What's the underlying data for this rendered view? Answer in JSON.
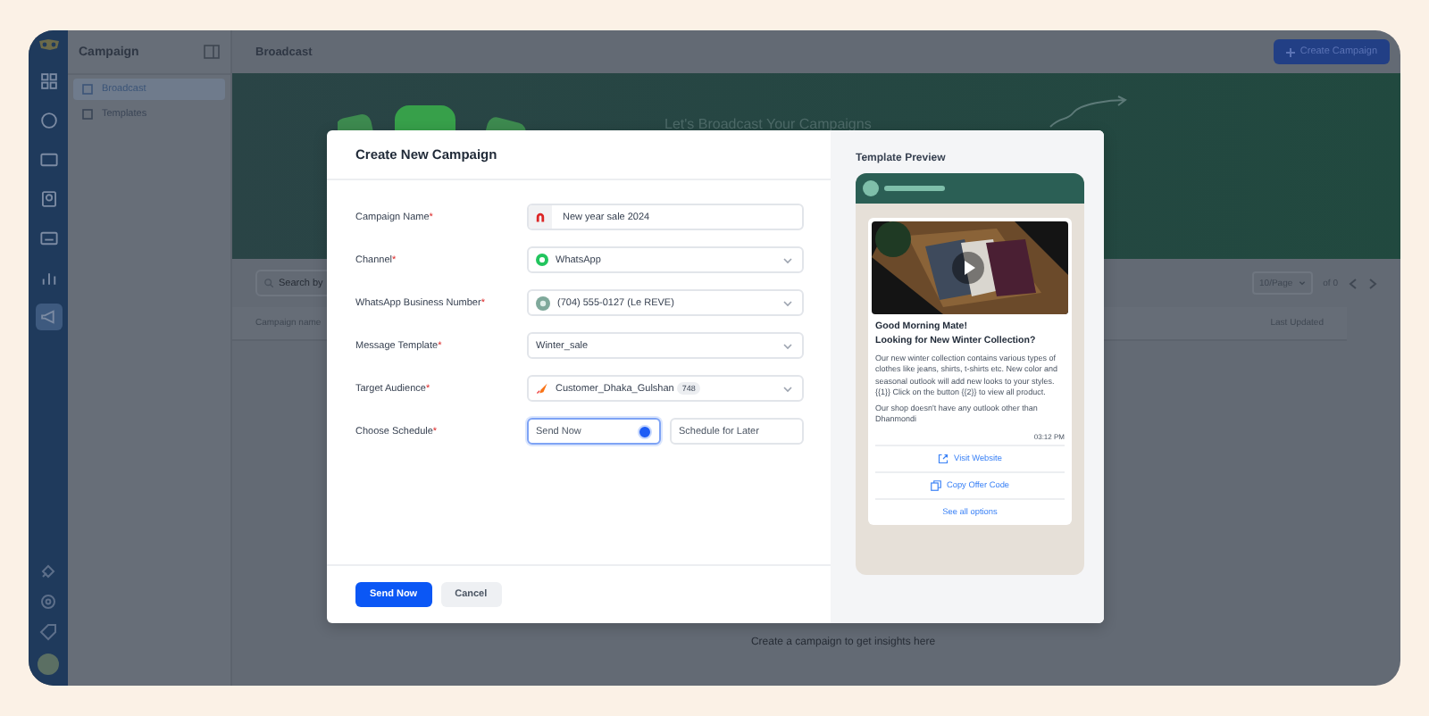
{
  "rail_items": [
    {
      "selected": false
    },
    {
      "selected": false
    },
    {
      "selected": false
    },
    {
      "selected": false
    },
    {
      "selected": false
    },
    {
      "selected": false
    },
    {
      "selected": true
    }
  ],
  "secondary_sidebar": {
    "title": "Campaign",
    "items": [
      {
        "label": "Broadcast",
        "selected": true
      },
      {
        "label": "Templates",
        "selected": false
      }
    ]
  },
  "header": {
    "title": "Broadcast",
    "button": "Create Campaign"
  },
  "banner": {
    "headline": "Let's Broadcast Your Campaigns"
  },
  "list": {
    "search_placeholder": "Search by",
    "page_size": "10/Page",
    "page_info": "of 0",
    "columns": [
      "Campaign name",
      "Last Updated"
    ],
    "empty_text": "Create a campaign to get insights here"
  },
  "modal": {
    "title": "Create New Campaign",
    "fields": [
      {
        "label": "Campaign Name",
        "required_mark": "*",
        "kind": "text",
        "value": "New year sale 2024"
      },
      {
        "label": "Channel",
        "required_mark": "*",
        "kind": "select",
        "value": "WhatsApp"
      },
      {
        "label": "WhatsApp Business Number",
        "required_mark": "*",
        "kind": "select",
        "value": "(704) 555-0127 (Le REVE)"
      },
      {
        "label": "Message Template",
        "required_mark": "*",
        "kind": "select",
        "value": "Winter_sale"
      },
      {
        "label": "Target Audience",
        "required_mark": "*",
        "kind": "select",
        "value": "Customer_Dhaka_Gulshan",
        "badge": "748"
      },
      {
        "label": "Choose Schedule",
        "required_mark": "*",
        "kind": "choice",
        "options": [
          {
            "label": "Send Now",
            "selected": true
          },
          {
            "label": "Schedule for Later",
            "selected": false
          }
        ]
      }
    ],
    "buttons": [
      {
        "label": "Send Now",
        "kind": "primary"
      },
      {
        "label": "Cancel",
        "kind": "secondary"
      }
    ]
  },
  "preview": {
    "title": "Template Preview",
    "heading": [
      "Good Morning Mate!",
      "Looking for New Winter Collection?"
    ],
    "body": [
      "Our new winter collection contains various types of clothes like jeans, shirts, t-shirts etc. New color and seasonal outlook will add new looks to your styles. {{1}} Click on the button {{2}} to view all product.",
      "Our shop doesn't have any outlook other than Dhanmondi"
    ],
    "time": "03:12 PM",
    "actions": [
      {
        "label": "Visit Website",
        "kind": "link"
      },
      {
        "label": "Copy Offer Code",
        "kind": "copy"
      },
      {
        "label": "See all options",
        "kind": "more"
      }
    ]
  }
}
